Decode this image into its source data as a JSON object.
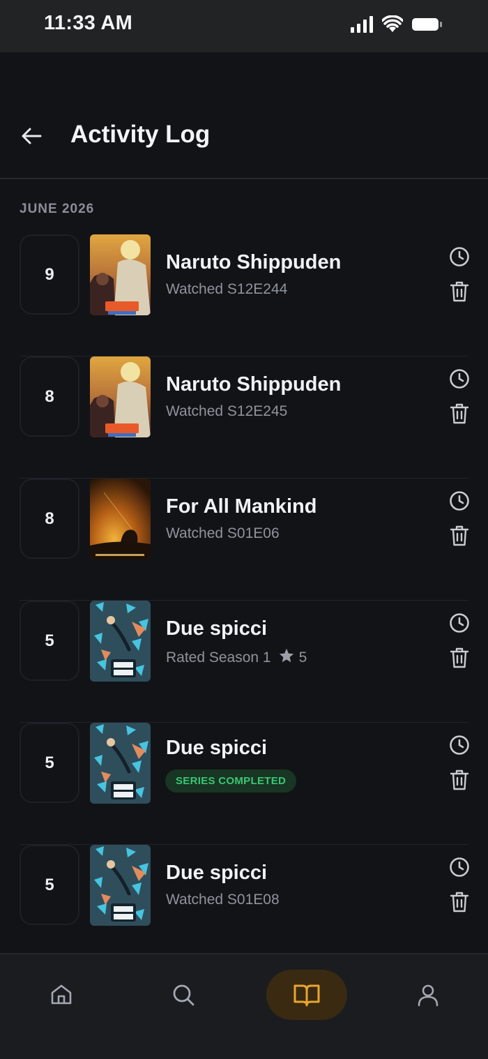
{
  "status_bar": {
    "time": "11:33 AM"
  },
  "header": {
    "title": "Activity Log",
    "back_icon": "arrow-left-icon"
  },
  "month_label": "JUNE 2026",
  "entries": [
    {
      "day": "9",
      "title": "Naruto Shippuden",
      "subtitle": "Watched S12E244",
      "poster": "naruto"
    },
    {
      "day": "8",
      "title": "Naruto Shippuden",
      "subtitle": "Watched S12E245",
      "poster": "naruto"
    },
    {
      "day": "8",
      "title": "For All Mankind",
      "subtitle": "Watched S01E06",
      "poster": "fam"
    },
    {
      "day": "5",
      "title": "Due spicci",
      "subtitle": "Rated Season 1",
      "rating": "5",
      "poster": "due"
    },
    {
      "day": "5",
      "title": "Due spicci",
      "badge": "SERIES COMPLETED",
      "poster": "due"
    },
    {
      "day": "5",
      "title": "Due spicci",
      "subtitle": "Watched S01E08",
      "poster": "due"
    }
  ],
  "nav": {
    "items": [
      "home-icon",
      "search-icon",
      "book-open-icon",
      "user-icon"
    ],
    "active": "book-open-icon",
    "accent": "#e8a630"
  }
}
